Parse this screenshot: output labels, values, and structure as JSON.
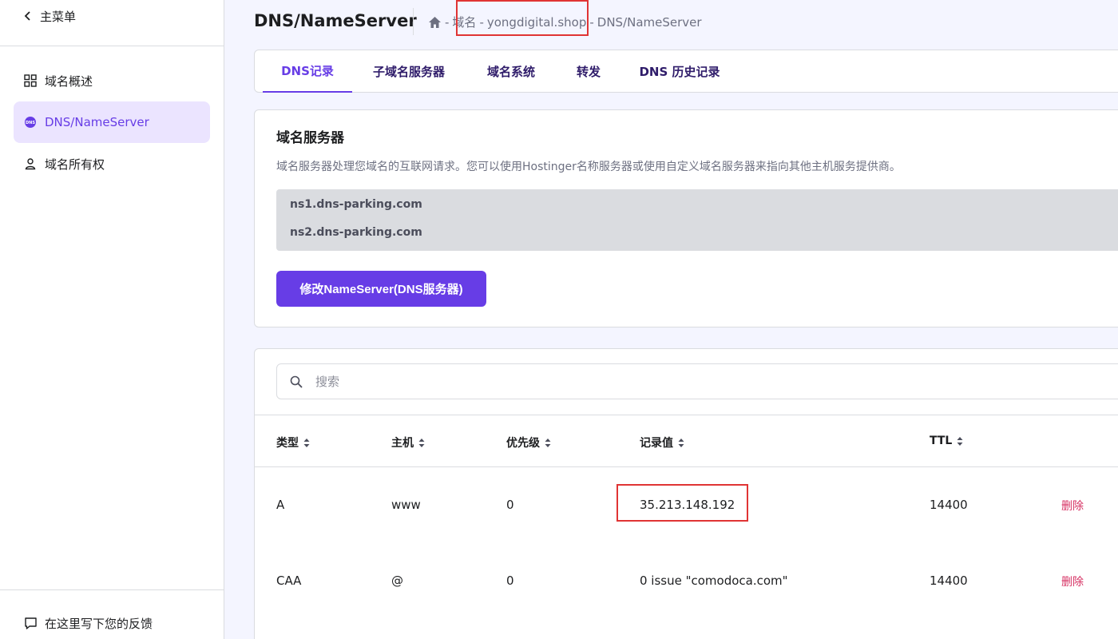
{
  "sidebar": {
    "back_label": "主菜单",
    "items": [
      {
        "label": "域名概述",
        "icon": "grid-icon"
      },
      {
        "label": "DNS/NameServer",
        "icon": "dns-icon"
      },
      {
        "label": "域名所有权",
        "icon": "person-icon"
      }
    ],
    "feedback_label": "在这里写下您的反馈"
  },
  "header": {
    "title": "DNS/NameServer",
    "breadcrumb": [
      "域名",
      "yongdigital.shop",
      "DNS/NameServer"
    ],
    "separator": "-"
  },
  "tabs": [
    {
      "label": "DNS记录"
    },
    {
      "label": "子域名服务器"
    },
    {
      "label": "域名系统"
    },
    {
      "label": "转发"
    },
    {
      "label": "DNS 历史记录"
    }
  ],
  "nameservers": {
    "title": "域名服务器",
    "description": "域名服务器处理您域名的互联网请求。您可以使用Hostinger名称服务器或使用自定义域名服务器来指向其他主机服务提供商。",
    "servers": [
      "ns1.dns-parking.com",
      "ns2.dns-parking.com"
    ],
    "button_label": "修改NameServer(DNS服务器)"
  },
  "records": {
    "search_placeholder": "搜索",
    "columns": [
      "类型",
      "主机",
      "优先级",
      "记录值",
      "TTL"
    ],
    "rows": [
      {
        "type": "A",
        "host": "www",
        "priority": "0",
        "value": "35.213.148.192",
        "ttl": "14400",
        "action": "删除"
      },
      {
        "type": "CAA",
        "host": "@",
        "priority": "0",
        "value": "0 issue \"comodoca.com\"",
        "ttl": "14400",
        "action": "删除"
      }
    ]
  },
  "colors": {
    "accent": "#673de6",
    "highlight": "#e03434",
    "delete": "#d63163"
  }
}
